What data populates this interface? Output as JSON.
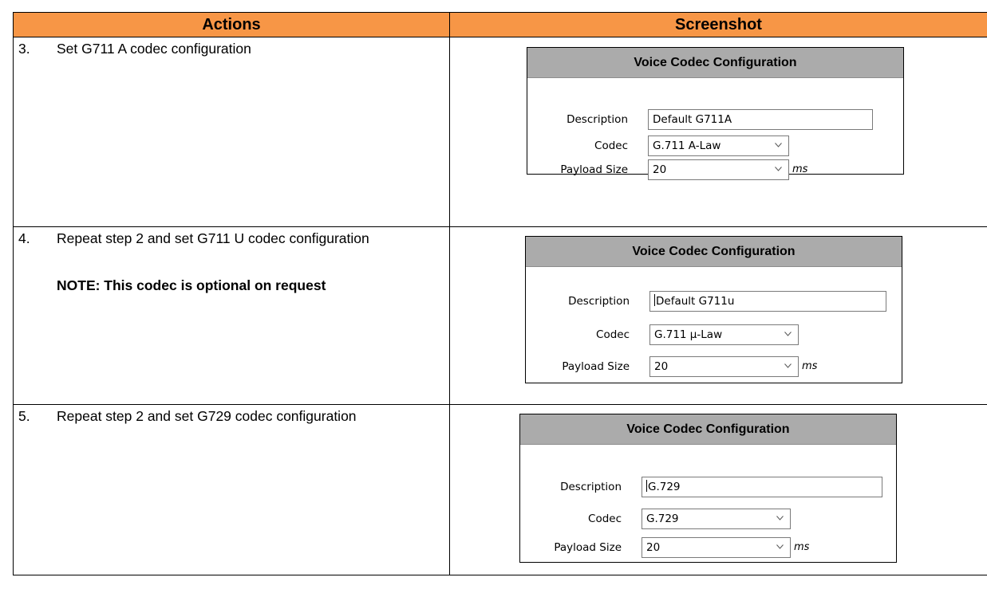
{
  "table": {
    "header_actions": "Actions",
    "header_screenshot": "Screenshot",
    "header_color": "#f79646"
  },
  "rows": [
    {
      "step": "3.",
      "text": "Set G711 A codec configuration",
      "note": "",
      "panel": {
        "title": "Voice Codec Configuration",
        "description_label": "Description",
        "description_value": "Default G711A",
        "codec_label": "Codec",
        "codec_value": "G.711 A-Law",
        "payload_label": "Payload Size",
        "payload_value": "20",
        "payload_unit": "ms"
      }
    },
    {
      "step": "4.",
      "text": "Repeat step 2 and set G711 U codec configuration",
      "note": "NOTE: This codec is optional on request",
      "panel": {
        "title": "Voice Codec Configuration",
        "description_label": "Description",
        "description_value": "Default G711u",
        "codec_label": "Codec",
        "codec_value": "G.711 µ-Law",
        "payload_label": "Payload Size",
        "payload_value": "20",
        "payload_unit": "ms"
      }
    },
    {
      "step": "5.",
      "text": "Repeat step 2 and set G729 codec configuration",
      "note": "",
      "panel": {
        "title": "Voice Codec Configuration",
        "description_label": "Description",
        "description_value": "G.729",
        "codec_label": "Codec",
        "codec_value": "G.729",
        "payload_label": "Payload Size",
        "payload_value": "20",
        "payload_unit": "ms"
      }
    }
  ],
  "icons": {
    "dropdown": "chevron-down-icon"
  },
  "colors": {
    "panel_header": "#ababab",
    "border": "#000000"
  }
}
